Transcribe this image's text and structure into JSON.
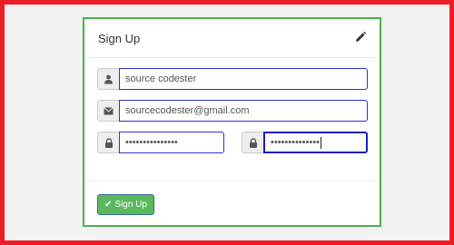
{
  "form": {
    "title": "Sign Up",
    "edit_icon": "pencil-icon",
    "username": {
      "icon": "user-icon",
      "value": "source codester"
    },
    "email": {
      "icon": "envelope-icon",
      "value": "sourcecodester@gmail.com"
    },
    "password": {
      "icon": "lock-icon",
      "value": "•••••••••••••••"
    },
    "confirm_password": {
      "icon": "lock-icon",
      "value": "••••••••••••••"
    },
    "submit": {
      "icon": "check-icon",
      "label": "Sign Up"
    }
  },
  "colors": {
    "outer_border": "#ee1c25",
    "panel_border": "#4cae4c",
    "input_border": "#2d33c8",
    "button_bg": "#5cb85c"
  }
}
